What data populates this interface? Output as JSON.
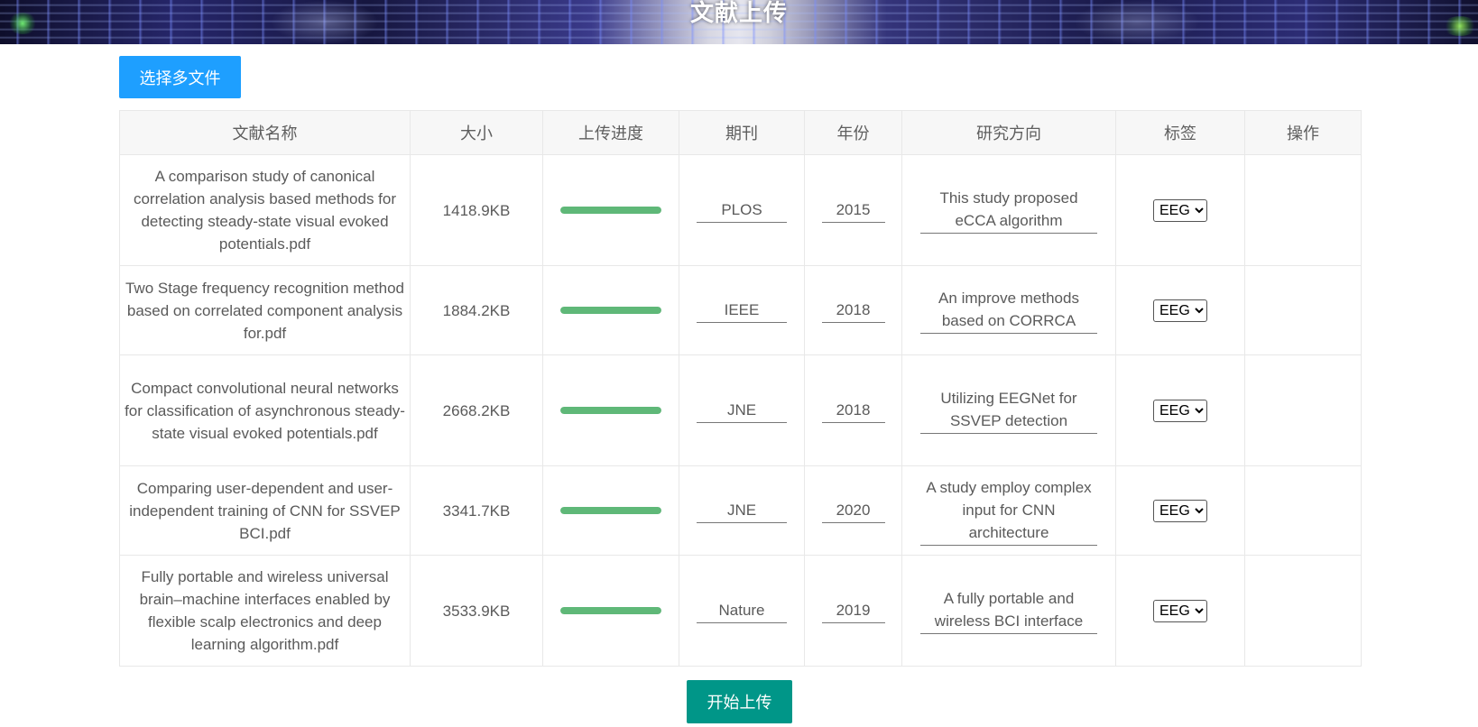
{
  "header": {
    "title": "文献上传"
  },
  "toolbar": {
    "select_files_label": "选择多文件"
  },
  "table": {
    "columns": [
      "文献名称",
      "大小",
      "上传进度",
      "期刊",
      "年份",
      "研究方向",
      "标签",
      "操作"
    ],
    "rows": [
      {
        "name": "A comparison study of canonical correlation analysis based methods for detecting steady-state visual evoked potentials.pdf",
        "size": "1418.9KB",
        "progress": 1.0,
        "journal": "PLOS",
        "year": "2015",
        "direction": "This study proposed eCCA algorithm",
        "tag": "EEG",
        "action": ""
      },
      {
        "name": "Two Stage frequency recognition method based on correlated component analysis for.pdf",
        "size": "1884.2KB",
        "progress": 1.0,
        "journal": "IEEE",
        "year": "2018",
        "direction": "An improve methods based on CORRCA",
        "tag": "EEG",
        "action": ""
      },
      {
        "name": "Compact convolutional neural networks for classification of asynchronous steady-state visual evoked potentials.pdf",
        "size": "2668.2KB",
        "progress": 1.0,
        "journal": "JNE",
        "year": "2018",
        "direction": "Utilizing EEGNet for SSVEP detection",
        "tag": "EEG",
        "action": ""
      },
      {
        "name": "Comparing user-dependent and user-independent training of CNN for SSVEP BCI.pdf",
        "size": "3341.7KB",
        "progress": 1.0,
        "journal": "JNE",
        "year": "2020",
        "direction": "A study employ complex input for CNN architecture",
        "tag": "EEG",
        "action": ""
      },
      {
        "name": "Fully portable and wireless universal brain–machine interfaces enabled by flexible scalp electronics and deep learning algorithm.pdf",
        "size": "3533.9KB",
        "progress": 1.0,
        "journal": "Nature",
        "year": "2019",
        "direction": "A fully portable and wireless BCI interface",
        "tag": "EEG",
        "action": ""
      }
    ]
  },
  "footer": {
    "start_upload_label": "开始上传"
  },
  "colors": {
    "select_button": "#1e9fff",
    "start_button": "#009688",
    "progress_fill": "#5fb878"
  }
}
